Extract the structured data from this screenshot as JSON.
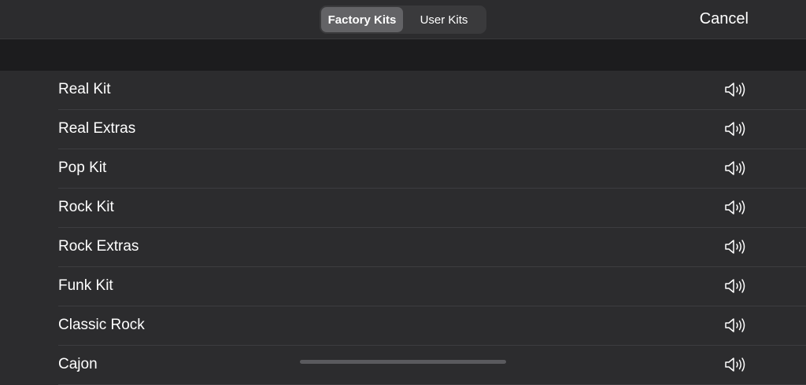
{
  "header": {
    "segments": [
      {
        "label": "Factory Kits",
        "selected": true
      },
      {
        "label": "User Kits",
        "selected": false
      }
    ],
    "cancel_label": "Cancel"
  },
  "kits": [
    {
      "label": "Real Kit",
      "icon": "speaker-icon"
    },
    {
      "label": "Real Extras",
      "icon": "speaker-icon"
    },
    {
      "label": "Pop Kit",
      "icon": "speaker-icon"
    },
    {
      "label": "Rock Kit",
      "icon": "speaker-icon"
    },
    {
      "label": "Rock Extras",
      "icon": "speaker-icon"
    },
    {
      "label": "Funk Kit",
      "icon": "speaker-icon"
    },
    {
      "label": "Classic Rock",
      "icon": "speaker-icon"
    },
    {
      "label": "Cajon",
      "icon": "speaker-icon"
    }
  ],
  "colors": {
    "background": "#2c2c2e",
    "section_header": "#1c1c1e",
    "segment_selected": "#636366",
    "text": "#ffffff"
  }
}
